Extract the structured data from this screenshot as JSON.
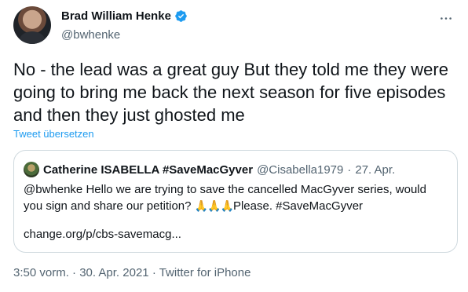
{
  "author": {
    "display_name": "Brad William Henke",
    "handle": "@bwhenke",
    "verified": true
  },
  "tweet": {
    "text": "No - the lead was a great guy But they told me they were going to bring me back the next season for five episodes and then they just ghosted me",
    "translate_label": "Tweet übersetzen"
  },
  "quote": {
    "display_name": "Catherine ISABELLA #SaveMacGyver",
    "handle": "@Cisabella1979",
    "separator": "·",
    "date": "27. Apr.",
    "text_before": "@bwhenke Hello we are trying to save the cancelled MacGyver series, would you sign and share our petition? ",
    "emoji": "🙏🙏🙏",
    "text_after": "Please. #SaveMacGyver",
    "link": "change.org/p/cbs-savemacg..."
  },
  "meta": {
    "time": "3:50 vorm.",
    "sep1": "·",
    "date": "30. Apr. 2021",
    "sep2": "·",
    "source": "Twitter for iPhone"
  },
  "colors": {
    "accent": "#1d9bf0",
    "secondary_text": "#536471",
    "border": "#cfd9de"
  },
  "icons": {
    "verified": "verified-badge-icon",
    "more": "more-dots-icon"
  }
}
